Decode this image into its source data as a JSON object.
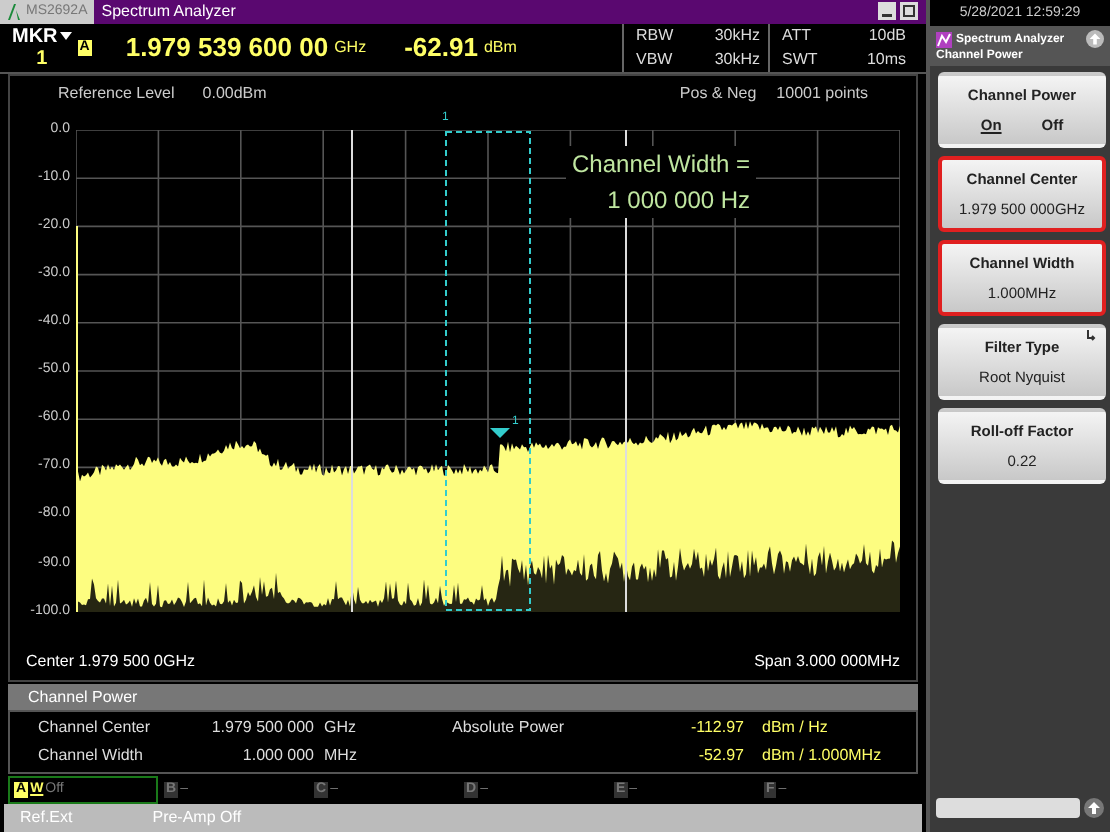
{
  "title_bar": {
    "model": "MS2692A",
    "title": "Spectrum Analyzer"
  },
  "marker": {
    "label": "MKR",
    "number": "1",
    "trace": "A",
    "frequency": "1.979 539 600 00",
    "frequency_unit": "GHz",
    "level": "-62.91",
    "level_unit": "dBm"
  },
  "settings": [
    {
      "label": "RBW",
      "value": "30kHz"
    },
    {
      "label": "VBW",
      "value": "30kHz"
    },
    {
      "label": "ATT",
      "value": "10dB"
    },
    {
      "label": "SWT",
      "value": "10ms"
    }
  ],
  "reference_level": {
    "label": "Reference Level",
    "value": "0.00dBm"
  },
  "detection": "Pos & Neg",
  "points": "10001 points",
  "plot": {
    "y_labels": [
      "0.0",
      "-10.0",
      "-20.0",
      "-30.0",
      "-40.0",
      "-50.0",
      "-60.0",
      "-70.0",
      "-80.0",
      "-90.0",
      "-100.0"
    ],
    "marker_labels": [
      "1",
      "1"
    ],
    "annotation": [
      "Channel Width =",
      "1 000 000 Hz"
    ]
  },
  "center": "Center 1.979 500 0GHz",
  "span": "Span 3.000 000MHz",
  "results": {
    "title": "Channel Power",
    "rows": [
      {
        "label": "Channel Center",
        "value": "1.979 500 000",
        "unit": "GHz",
        "power_label": "Absolute Power",
        "power": "-112.97",
        "power_unit": "dBm / Hz"
      },
      {
        "label": "Channel Width",
        "value": "1.000 000",
        "unit": "MHz",
        "power": "-52.97",
        "power_unit": "dBm / 1.000MHz"
      }
    ]
  },
  "traces": [
    {
      "letter": "A",
      "mode": "W",
      "status": "Off",
      "selected": true
    },
    {
      "letter": "B",
      "status": "–",
      "selected": false
    },
    {
      "letter": "C",
      "status": "–",
      "selected": false
    },
    {
      "letter": "D",
      "status": "–",
      "selected": false
    },
    {
      "letter": "E",
      "status": "–",
      "selected": false
    },
    {
      "letter": "F",
      "status": "–",
      "selected": false
    }
  ],
  "status_bar": [
    "Ref.Ext",
    "Pre-Amp Off"
  ],
  "side_panel": {
    "datetime": "5/28/2021 12:59:29",
    "app": "Spectrum Analyzer",
    "function": "Channel Power",
    "buttons": [
      {
        "kind": "toggle",
        "label": "Channel Power",
        "options": [
          {
            "label": "On",
            "selected": true
          },
          {
            "label": "Off",
            "selected": false
          }
        ]
      },
      {
        "kind": "value",
        "label": "Channel Center",
        "value": "1.979 500 000GHz",
        "highlighted": true,
        "submenu": false
      },
      {
        "kind": "value",
        "label": "Channel Width",
        "value": "1.000MHz",
        "highlighted": true,
        "submenu": false
      },
      {
        "kind": "value",
        "label": "Filter Type",
        "value": "Root Nyquist",
        "highlighted": false,
        "submenu": true
      },
      {
        "kind": "value",
        "label": "Roll-off Factor",
        "value": "0.22",
        "highlighted": false,
        "submenu": false
      }
    ]
  }
}
